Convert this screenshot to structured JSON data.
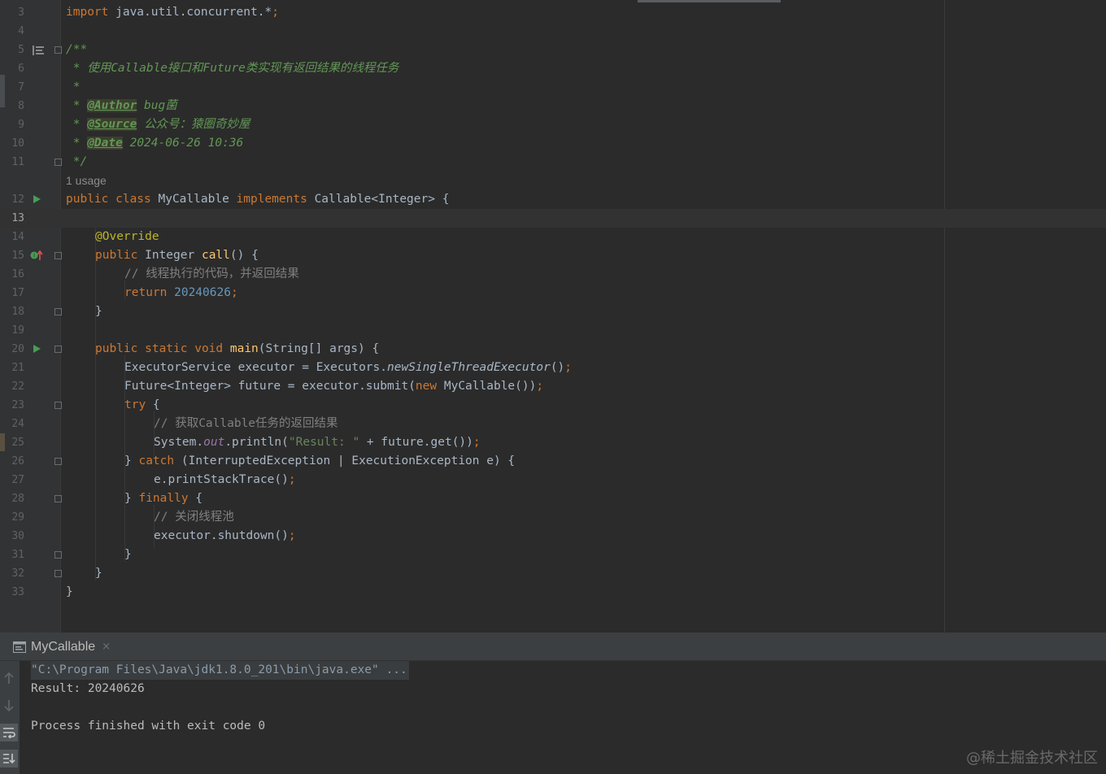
{
  "editor": {
    "usage_hint": "1 usage",
    "line_numbers": [
      "3",
      "4",
      "5",
      "6",
      "7",
      "8",
      "9",
      "10",
      "11",
      "12",
      "13",
      "14",
      "15",
      "16",
      "17",
      "18",
      "19",
      "20",
      "21",
      "22",
      "23",
      "24",
      "25",
      "26",
      "27",
      "28",
      "29",
      "30",
      "31",
      "32",
      "33"
    ],
    "current_line": "13",
    "code": {
      "l3_import": "import",
      "l3_pkg": " java.util.concurrent.*",
      "l3_semi": ";",
      "l5": "/**",
      "l6": " * 使用Callable接口和Future类实现有返回结果的线程任务",
      "l7": " *",
      "l8_star": " * ",
      "l8_tag": "@Author",
      "l8_val": " bug菌",
      "l9_star": " * ",
      "l9_tag": "@Source",
      "l9_val": " 公众号：猿圈奇妙屋",
      "l10_star": " * ",
      "l10_tag": "@Date",
      "l10_val": " 2024-06-26 10:36",
      "l11": " */",
      "l12_kw": "public class",
      "l12_name": " MyCallable ",
      "l12_impl": "implements",
      "l12_rest": " Callable<Integer> {",
      "l14_ann": "@Override",
      "l15_kw": "public",
      "l15_type": " Integer ",
      "l15_fn": "call",
      "l15_rest": "() {",
      "l16": "// 线程执行的代码，并返回结果",
      "l17_kw": "return",
      "l17_num": " 20240626",
      "l17_semi": ";",
      "l18": "}",
      "l20_kw": "public static void",
      "l20_fn": " main",
      "l20_rest": "(String[] args) {",
      "l21_a": "ExecutorService executor = Executors.",
      "l21_b": "newSingleThreadExecutor",
      "l21_c": "()",
      "l21_semi": ";",
      "l22_a": "Future<Integer> future = executor.submit(",
      "l22_new": "new",
      "l22_b": " MyCallable())",
      "l22_semi": ";",
      "l23_kw": "try",
      "l23_rest": " {",
      "l24": "// 获取Callable任务的返回结果",
      "l25_a": "System.",
      "l25_out": "out",
      "l25_b": ".println(",
      "l25_str": "\"Result: \"",
      "l25_c": " + future.get())",
      "l25_semi": ";",
      "l26_a": "} ",
      "l26_kw": "catch",
      "l26_b": " (InterruptedException | ExecutionException e) {",
      "l27_a": "e.printStackTrace()",
      "l27_semi": ";",
      "l28_a": "} ",
      "l28_kw": "finally",
      "l28_b": " {",
      "l29": "// 关闭线程池",
      "l30_a": "executor.shutdown()",
      "l30_semi": ";",
      "l31": "}",
      "l32": "}",
      "l33": "}"
    }
  },
  "run_panel": {
    "tab_label": "MyCallable",
    "tab_close": "×",
    "tab_icon": "console-icon",
    "tools": [
      "up-arrow-icon",
      "down-arrow-icon",
      "soft-wrap-icon",
      "scroll-to-end-icon"
    ],
    "lines": [
      "\"C:\\Program Files\\Java\\jdk1.8.0_201\\bin\\java.exe\" ...",
      "Result: 20240626",
      "",
      "Process finished with exit code 0"
    ]
  },
  "watermark": "@稀土掘金技术社区",
  "colors": {
    "background": "#2b2b2b",
    "gutter": "#313335",
    "keyword": "#cc7832",
    "doc_comment": "#629755",
    "annotation": "#bbb529",
    "number": "#6897bb",
    "string": "#6a8759",
    "method": "#ffc66d",
    "static_field": "#9876aa",
    "text": "#a9b7c6",
    "run_icon": "#499c54"
  }
}
